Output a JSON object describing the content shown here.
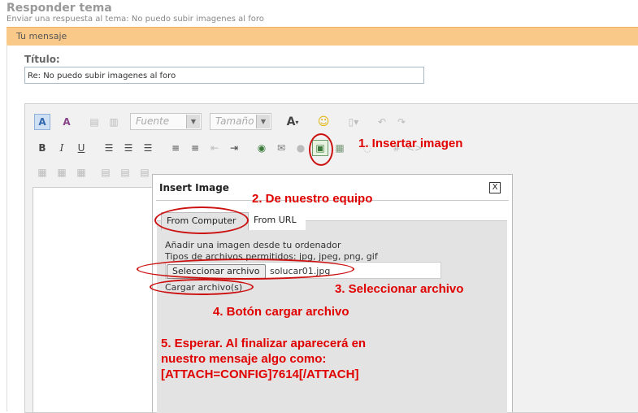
{
  "header": {
    "title": "Responder tema",
    "subtitle": "Enviar una respuesta al tema: No puedo subir imagenes al foro",
    "section": "Tu mensaje"
  },
  "form": {
    "title_label": "Título:",
    "title_value": "Re: No puedo subir imagenes al foro"
  },
  "toolbar": {
    "font_select": "Fuente",
    "size_select": "Tamaño",
    "row1_icons": [
      "switch-mode-icon",
      "remove-format-icon",
      "paste-icon",
      "paste-text-icon",
      "font-select",
      "size-select",
      "text-color-icon",
      "smiley-icon",
      "paste-special-icon",
      "undo-icon",
      "redo-icon"
    ],
    "row2_icons": [
      "bold-icon",
      "italic-icon",
      "underline-icon",
      "align-left-icon",
      "align-center-icon",
      "align-right-icon",
      "numbered-list-icon",
      "bullet-list-icon",
      "outdent-icon",
      "indent-icon",
      "link-icon",
      "email-icon",
      "unlink-icon",
      "insert-image-icon",
      "insert-video-icon"
    ]
  },
  "dialog": {
    "title": "Insert Image",
    "close": "X",
    "tabs": [
      "From Computer",
      "From URL"
    ],
    "description": "Añadir una imagen desde tu ordenador",
    "types": "Tipos de archivos permitidos: jpg, jpeg, png, gif",
    "select_button": "Seleccionar archivo",
    "file_name": "solucar01.jpg",
    "upload_button": "Cargar archivo(s)"
  },
  "annotations": {
    "step1": "1. Insertar imagen",
    "step2": "2. De nuestro equipo",
    "step3": "3. Seleccionar archivo",
    "step4": "4. Botón cargar archivo",
    "step5_line1": "5. Esperar. Al finalizar aparecerá en",
    "step5_line2": "nuestro mensaje algo como:",
    "step5_line3": "[ATTACH=CONFIG]7614[/ATTACH]"
  },
  "colors": {
    "section_bar": "#f9c98a",
    "annotation": "#e00000"
  }
}
